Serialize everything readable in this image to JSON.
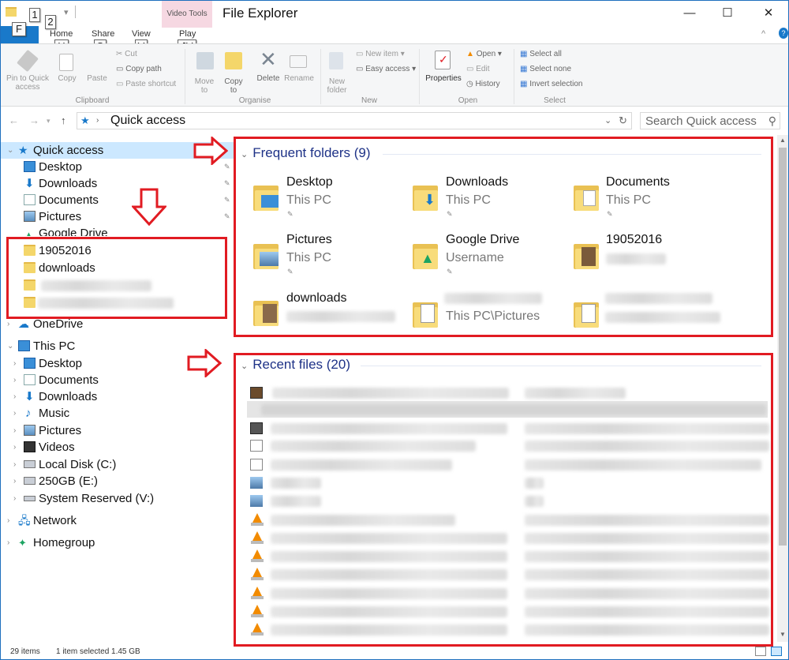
{
  "window": {
    "title": "File Explorer",
    "context_group": "Video Tools"
  },
  "tabs": [
    {
      "label": "Home"
    },
    {
      "label": "Share"
    },
    {
      "label": "View"
    },
    {
      "label": "Play"
    }
  ],
  "keytips": {
    "file": "F",
    "qa1": "1",
    "qa2": "2",
    "home": "H",
    "share": "S",
    "view": "V",
    "play": "JV",
    "help": "?"
  },
  "ribbon": {
    "clipboard": {
      "pin": "Pin to Quick\naccess",
      "copy": "Copy",
      "paste": "Paste",
      "cut": "Cut",
      "copy_path": "Copy path",
      "paste_shortcut": "Paste shortcut",
      "group": "Clipboard"
    },
    "organise": {
      "move_to": "Move\nto",
      "copy_to": "Copy\nto",
      "delete": "Delete",
      "rename": "Rename",
      "group": "Organise"
    },
    "new": {
      "new_folder": "New\nfolder",
      "new_item": "New item",
      "easy_access": "Easy access",
      "group": "New"
    },
    "open": {
      "properties": "Properties",
      "open": "Open",
      "edit": "Edit",
      "history": "History",
      "group": "Open"
    },
    "select": {
      "select_all": "Select all",
      "select_none": "Select none",
      "invert": "Invert selection",
      "group": "Select"
    }
  },
  "address": {
    "path": "Quick access",
    "search_placeholder": "Search Quick access"
  },
  "nav": {
    "quick_access": "Quick access",
    "qa_items": [
      "Desktop",
      "Downloads",
      "Documents",
      "Pictures",
      "Google Drive",
      "19052016",
      "downloads"
    ],
    "onedrive": "OneDrive",
    "this_pc": "This PC",
    "pc_items": [
      "Desktop",
      "Documents",
      "Downloads",
      "Music",
      "Pictures",
      "Videos",
      "Local Disk (C:)",
      "250GB (E:)",
      "System Reserved (V:)"
    ],
    "network": "Network",
    "homegroup": "Homegroup"
  },
  "frequent": {
    "header": "Frequent folders (9)",
    "folders": [
      {
        "name": "Desktop",
        "sub": "This PC"
      },
      {
        "name": "Downloads",
        "sub": "This PC"
      },
      {
        "name": "Documents",
        "sub": "This PC"
      },
      {
        "name": "Pictures",
        "sub": "This PC"
      },
      {
        "name": "Google Drive",
        "sub": "Username"
      },
      {
        "name": "19052016",
        "sub": ""
      },
      {
        "name": "downloads",
        "sub": ""
      },
      {
        "name": "",
        "sub": "This PC\\Pictures"
      },
      {
        "name": "",
        "sub": ""
      }
    ]
  },
  "recent": {
    "header": "Recent files (20)"
  },
  "status": {
    "count": "29 items",
    "selected": "1 item selected  1.45 GB"
  },
  "colors": {
    "accent": "#1979ca",
    "highlight": "#e11b22",
    "section": "#1e3287",
    "selection": "#cce8ff"
  }
}
